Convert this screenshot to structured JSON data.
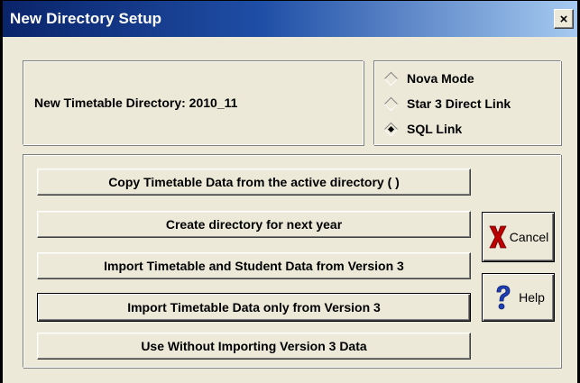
{
  "window": {
    "title": "New Directory Setup",
    "close_glyph": "×"
  },
  "info": {
    "directory_text": "New Timetable Directory: 2010_11"
  },
  "mode": {
    "options": [
      {
        "label": "Nova Mode",
        "checked": false
      },
      {
        "label": "Star 3 Direct Link",
        "checked": false
      },
      {
        "label": "SQL Link",
        "checked": true
      }
    ]
  },
  "actions": {
    "copy_label": "Copy Timetable Data from the active directory ( )",
    "create_label": "Create directory for next year",
    "import_all_label": "Import Timetable and Student Data from Version 3",
    "import_timetable_label": "Import Timetable Data only from Version 3",
    "no_import_label": "Use Without Importing Version 3 Data"
  },
  "side_buttons": {
    "cancel_label": "Cancel",
    "cancel_icon": "red-x-icon",
    "help_label": "Help",
    "help_icon": "question-mark-icon"
  },
  "colors": {
    "title_bar_start": "#0a246a",
    "title_bar_end": "#a6caf0",
    "dialog_face": "#ece9d8",
    "cancel_icon": "#c00000",
    "help_icon": "#1e3fb5"
  }
}
